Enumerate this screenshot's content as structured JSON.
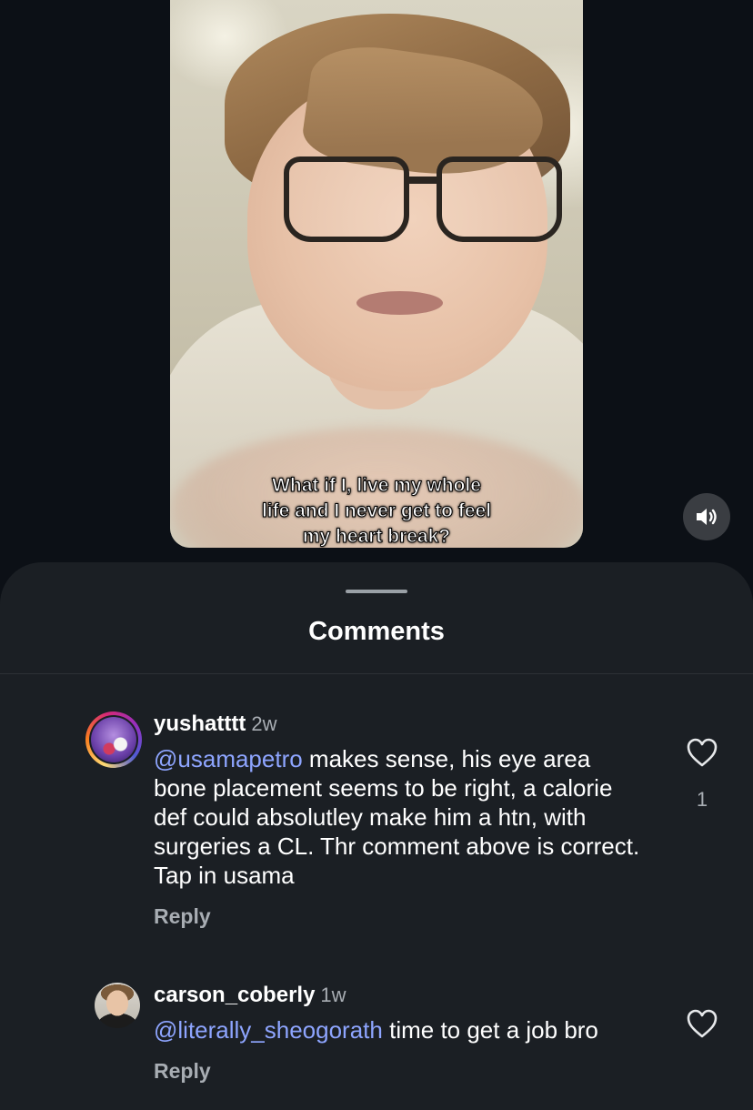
{
  "video": {
    "caption_lines": [
      "What if I, live my whole",
      "life and I never get to feel",
      "my heart break?"
    ],
    "mute_icon": "speaker-on-icon"
  },
  "sheet": {
    "title": "Comments"
  },
  "comments": [
    {
      "username": "yushatttt",
      "time": "2w",
      "mention": "@usamapetro",
      "text": " makes sense, his eye area bone placement seems to be right, a calorie def could absolutley make him a htn, with surgeries a CL. Thr comment above is correct. Tap in usama",
      "reply_label": "Reply",
      "like_count": "1",
      "like_icon": "heart-outline-icon",
      "has_story_ring": true
    },
    {
      "username": "carson_coberly",
      "time": "1w",
      "mention": "@literally_sheogorath",
      "text": " time to get a job bro",
      "reply_label": "Reply",
      "like_count": "",
      "like_icon": "heart-outline-icon",
      "has_story_ring": false
    }
  ],
  "colors": {
    "background": "#0c1016",
    "sheet": "#1b1f24",
    "mention": "#8ea5ff",
    "secondary_text": "#a8adb3"
  }
}
